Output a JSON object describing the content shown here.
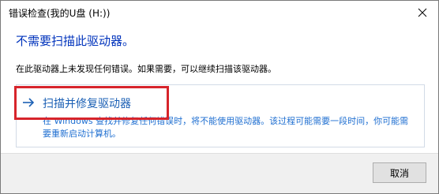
{
  "window": {
    "title": "错误检查(我的U盘 (H:))",
    "close_icon": "close-icon"
  },
  "main": {
    "heading": "不需要扫描此驱动器。",
    "description": "在此驱动器上未发现任何错误。如果需要，可以继续扫描该驱动器。",
    "option": {
      "icon": "arrow-right-icon",
      "title": "扫描并修复驱动器",
      "detail": "在 Windows 查找并修复任何错误时，将不能使用驱动器。该过程可能需要一段时间，你可能需要重新启动计算机。"
    }
  },
  "footer": {
    "cancel_label": "取消"
  },
  "colors": {
    "heading": "#0033bc",
    "link": "#1a5fb4",
    "highlight": "#d7242b",
    "footer_bg": "#f0f0f0"
  }
}
